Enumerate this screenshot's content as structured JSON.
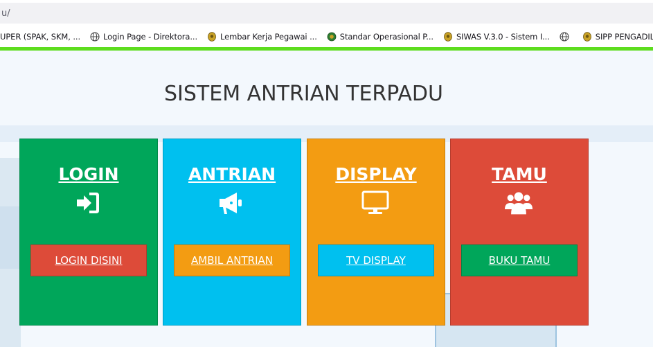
{
  "browser": {
    "url": "u/",
    "bookmarks": [
      {
        "label": "UPER (SPAK, SKM, ...",
        "icon": "none"
      },
      {
        "label": "Login Page - Direktora...",
        "icon": "globe-icon"
      },
      {
        "label": "Lembar Kerja Pegawai ...",
        "icon": "emblem-icon"
      },
      {
        "label": "Standar Operasional P...",
        "icon": "green-emblem-icon"
      },
      {
        "label": "SIWAS V.3.0 - Sistem I...",
        "icon": "emblem-icon"
      },
      {
        "label": "",
        "icon": "globe-icon"
      },
      {
        "label": "SIPP PENGADILAN NE...",
        "icon": "emblem-icon"
      }
    ]
  },
  "page": {
    "title": "SISTEM ANTRIAN TERPADU",
    "cards": [
      {
        "heading": "LOGIN",
        "icon": "sign-in-icon",
        "button": "LOGIN DISINI",
        "color": "#00a65a",
        "button_color": "#dd4b39"
      },
      {
        "heading": "ANTRIAN",
        "icon": "bullhorn-icon",
        "button": "AMBIL ANTRIAN",
        "color": "#00c0ef",
        "button_color": "#f39c12"
      },
      {
        "heading": "DISPLAY",
        "icon": "monitor-icon",
        "button": "TV DISPLAY",
        "color": "#f39c12",
        "button_color": "#00c0ef"
      },
      {
        "heading": "TAMU",
        "icon": "users-icon",
        "button": "BUKU TAMU",
        "color": "#dd4b39",
        "button_color": "#00a65a"
      }
    ]
  }
}
